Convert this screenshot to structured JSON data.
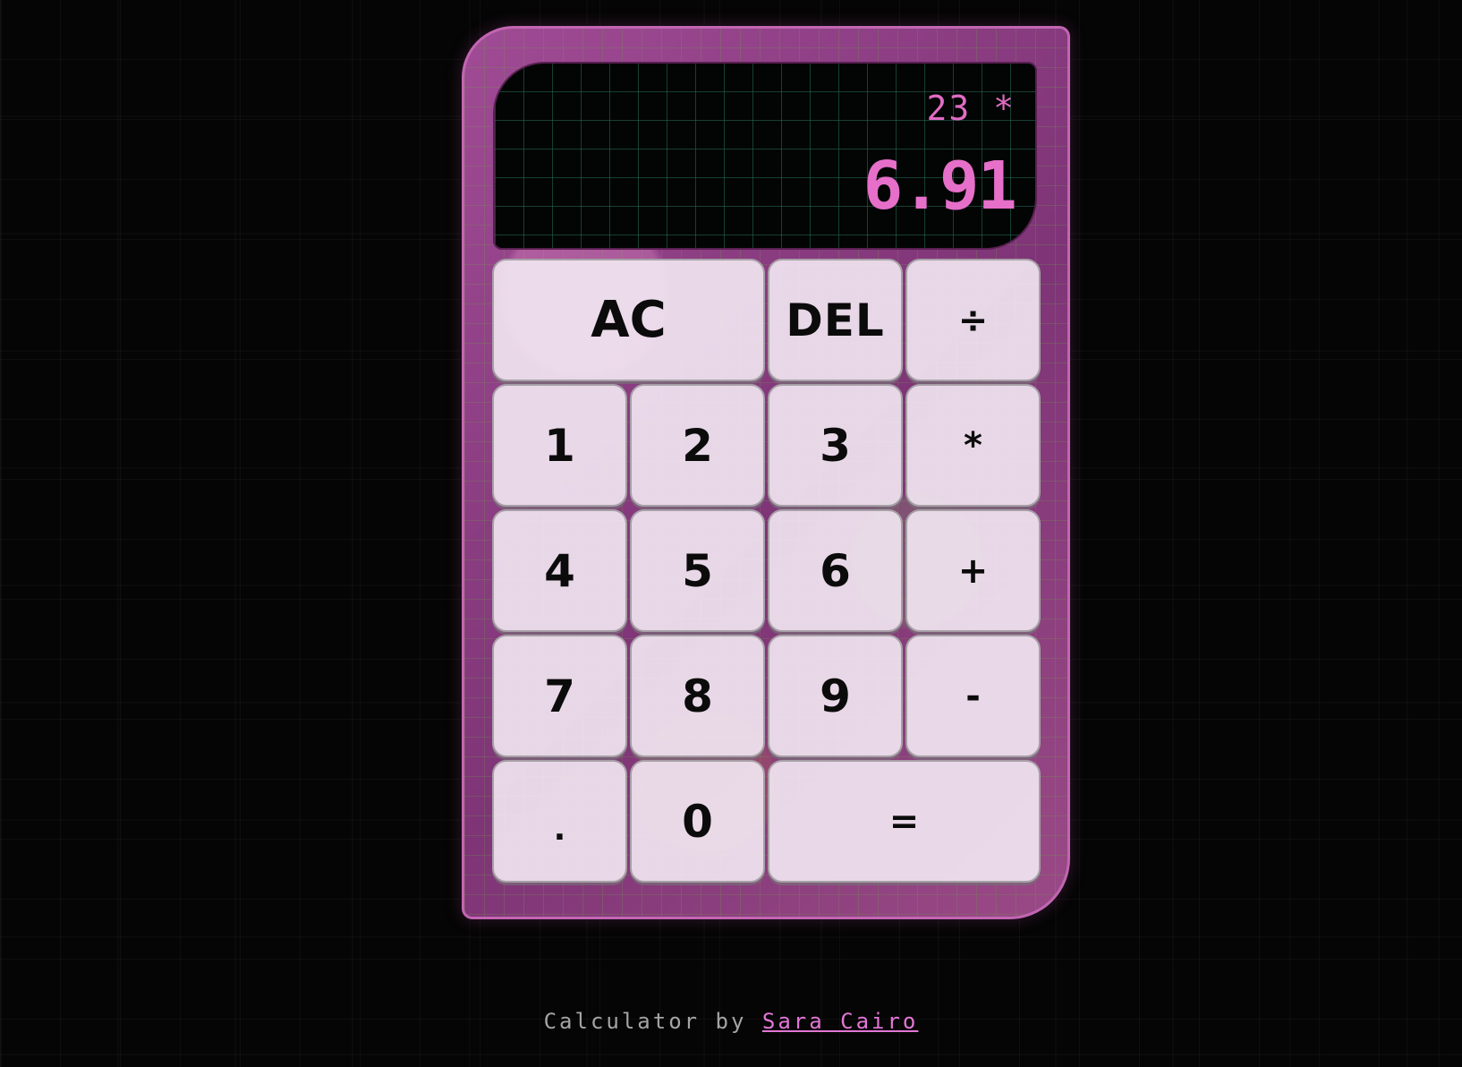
{
  "display": {
    "previous_operand": "23 *",
    "current_operand": "6.91"
  },
  "keys": {
    "ac": "AC",
    "del": "DEL",
    "divide": "÷",
    "one": "1",
    "two": "2",
    "three": "3",
    "multiply": "*",
    "four": "4",
    "five": "5",
    "six": "6",
    "add": "+",
    "seven": "7",
    "eight": "8",
    "nine": "9",
    "subtract": "-",
    "dot": ".",
    "zero": "0",
    "equals": "="
  },
  "footer": {
    "prefix": "Calculator by ",
    "author": "Sara Cairo"
  },
  "colors": {
    "display_text": "#e66fca",
    "body_accent": "#8f3f86",
    "key_face": "#f3e9f3",
    "link": "#e376d6"
  }
}
